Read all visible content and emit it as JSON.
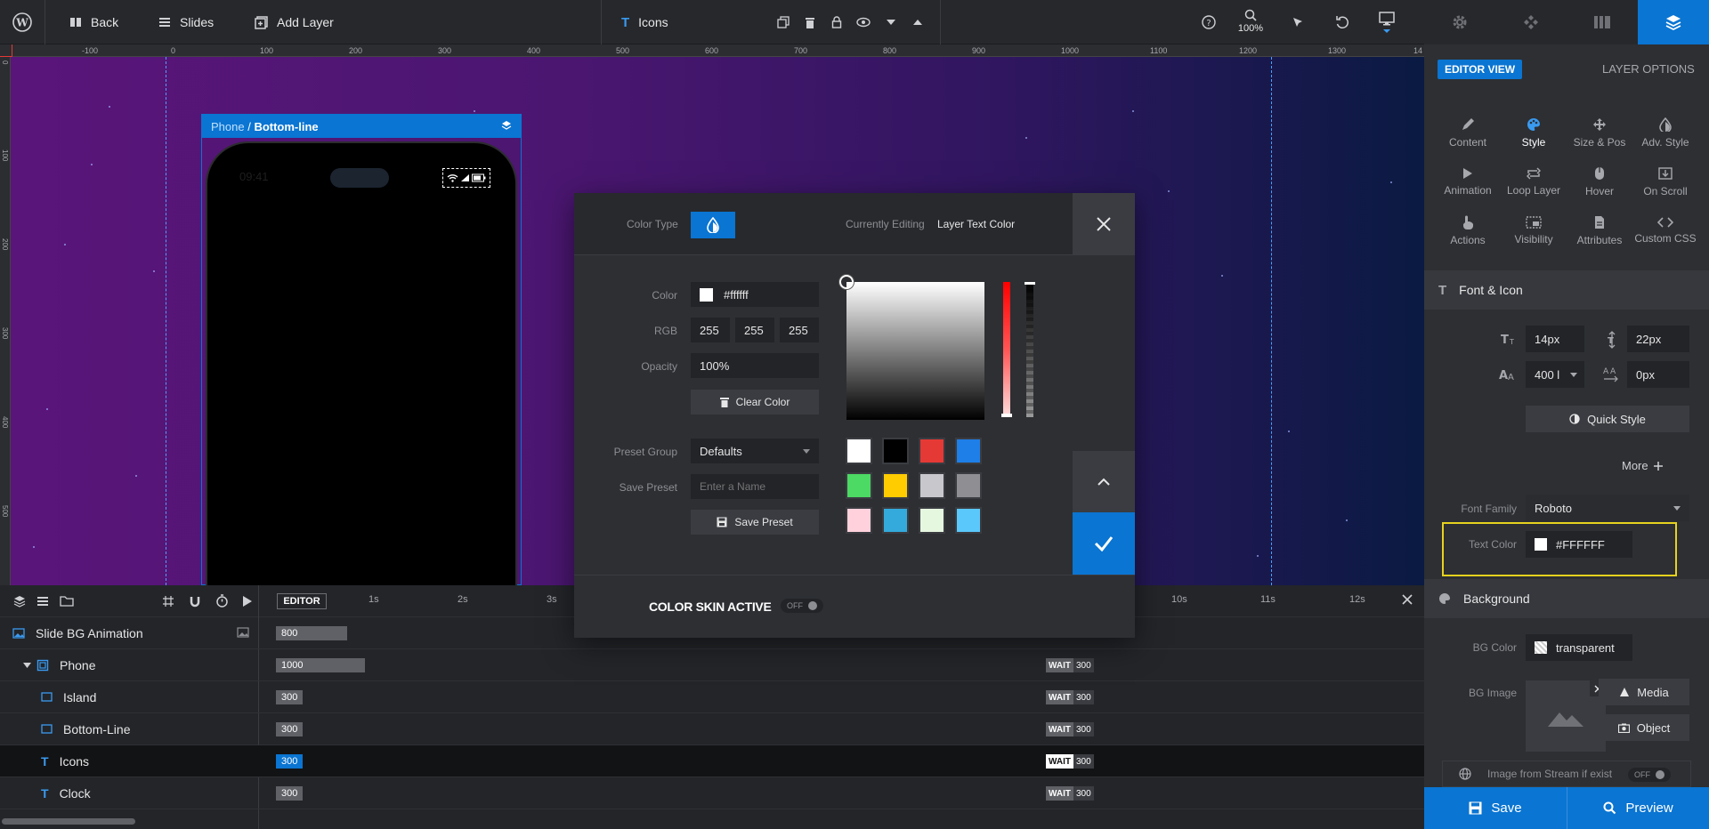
{
  "topbar": {
    "back_label": "Back",
    "slides_label": "Slides",
    "add_layer_label": "Add Layer",
    "layer_name": "Icons",
    "zoom": "100%"
  },
  "ruler": {
    "h_ticks": [
      "-100",
      "0",
      "100",
      "200",
      "300",
      "400",
      "500",
      "600",
      "700",
      "800",
      "900",
      "1000",
      "1100",
      "1200",
      "1300",
      "14"
    ],
    "v_ticks": [
      "0",
      "100",
      "200",
      "300",
      "400",
      "500"
    ]
  },
  "canvas": {
    "breadcrumb_parent": "Phone",
    "breadcrumb_sep": " / ",
    "breadcrumb_current": "Bottom-line",
    "phone_time": "09:41"
  },
  "color_modal": {
    "color_type_label": "Color Type",
    "currently_editing_label": "Currently Editing",
    "currently_editing_value": "Layer Text Color",
    "color_label": "Color",
    "color_value": "#ffffff",
    "rgb_label": "RGB",
    "rgb": [
      "255",
      "255",
      "255"
    ],
    "opacity_label": "Opacity",
    "opacity_value": "100%",
    "clear_color_label": "Clear Color",
    "preset_group_label": "Preset Group",
    "preset_group_value": "Defaults",
    "save_preset_label": "Save Preset",
    "save_preset_placeholder": "Enter a Name",
    "save_preset_button": "Save Preset",
    "color_skin_label": "COLOR SKIN ACTIVE",
    "color_skin_toggle": "OFF",
    "swatches": [
      "#ffffff",
      "#000000",
      "#e53935",
      "#1e7fe8",
      "#4cd964",
      "#ffcc00",
      "#c7c7cc",
      "#8e8e93",
      "#ffd1dc",
      "#34aadc",
      "#e6f7e0",
      "#5ac8fa"
    ]
  },
  "timeline": {
    "editor_label": "EDITOR",
    "time_marks": [
      "1s",
      "2s",
      "3s",
      "10s",
      "11s",
      "12s"
    ],
    "rows": [
      {
        "name": "Slide BG Animation",
        "bar": "800"
      },
      {
        "name": "Phone",
        "bar": "1000",
        "wait": "WAIT",
        "end": "300"
      },
      {
        "name": "Island",
        "bar": "300",
        "wait": "WAIT",
        "end": "300"
      },
      {
        "name": "Bottom-Line",
        "bar": "300",
        "wait": "WAIT",
        "end": "300"
      },
      {
        "name": "Icons",
        "bar": "300",
        "wait": "WAIT",
        "end": "300"
      },
      {
        "name": "Clock",
        "bar": "300",
        "wait": "WAIT",
        "end": "300"
      }
    ]
  },
  "right_panel": {
    "editor_view_label": "EDITOR VIEW",
    "layer_options_label": "LAYER OPTIONS",
    "options": [
      "Content",
      "Style",
      "Size & Pos",
      "Adv. Style",
      "Animation",
      "Loop Layer",
      "Hover",
      "On Scroll",
      "Actions",
      "Visibility",
      "Attributes",
      "Custom CSS"
    ],
    "font_icon_header": "Font & Icon",
    "font_size": "14px",
    "line_height": "22px",
    "font_weight": "400 l",
    "letter_spacing": "0px",
    "quick_style_label": "Quick Style",
    "more_label": "More",
    "font_family_label": "Font Family",
    "font_family_value": "Roboto",
    "text_color_label": "Text Color",
    "text_color_value": "#FFFFFF",
    "background_header": "Background",
    "bg_color_label": "BG Color",
    "bg_color_value": "transparent",
    "bg_image_label": "BG Image",
    "media_label": "Media",
    "object_label": "Object",
    "stream_label": "Image from Stream if exist",
    "stream_toggle": "OFF",
    "save_label": "Save",
    "preview_label": "Preview"
  },
  "colors": {
    "accent": "#0a75d2",
    "highlight_box": "#e6d21e"
  }
}
